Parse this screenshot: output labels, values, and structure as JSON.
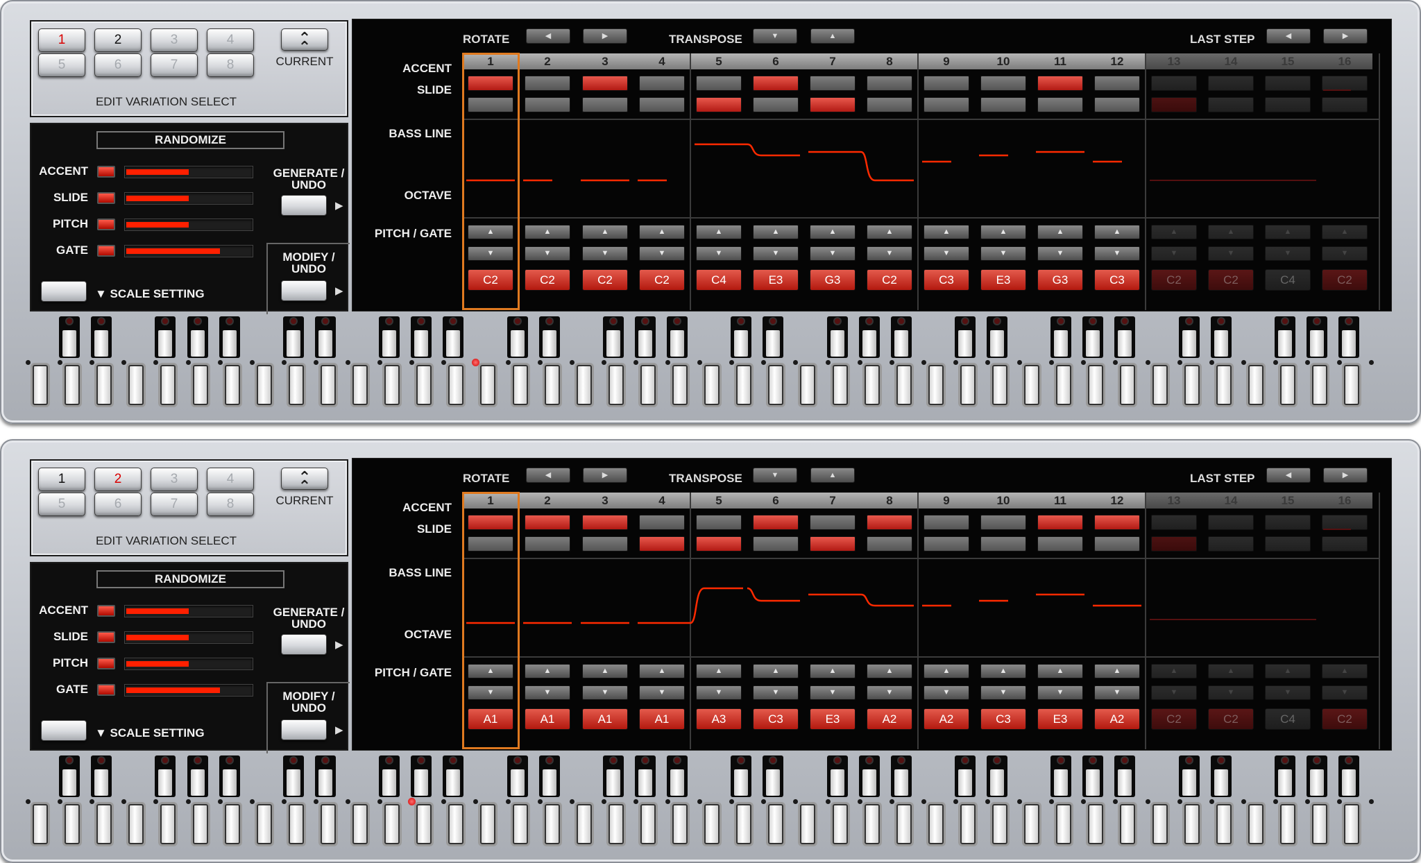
{
  "panels": [
    {
      "variation": {
        "buttons": [
          "1",
          "2",
          "3",
          "4",
          "5",
          "6",
          "7",
          "8"
        ],
        "selected": "2",
        "playing": "1",
        "current_label": "CURRENT",
        "current_icon": "double-chevron-up",
        "label": "EDIT VARIATION SELECT"
      },
      "randomize": {
        "title": "RANDOMIZE",
        "rows": [
          {
            "label": "ACCENT",
            "level": 0.5
          },
          {
            "label": "SLIDE",
            "level": 0.5
          },
          {
            "label": "PITCH",
            "level": 0.5
          },
          {
            "label": "GATE",
            "level": 0.75
          }
        ],
        "generate_label": "GENERATE / UNDO",
        "modify_label": "MODIFY / UNDO",
        "scale_label": "▼ SCALE SETTING"
      },
      "top": {
        "rotate_label": "ROTATE",
        "transpose_label": "TRANSPOSE",
        "last_step_label": "LAST STEP"
      },
      "rows": {
        "accent": "ACCENT",
        "slide": "SLIDE",
        "bass_line": "BASS LINE",
        "octave": "OCTAVE",
        "pitch_gate": "PITCH / GATE"
      },
      "steps": [
        "1",
        "2",
        "3",
        "4",
        "5",
        "6",
        "7",
        "8",
        "9",
        "10",
        "11",
        "12",
        "13",
        "14",
        "15",
        "16"
      ],
      "last_step": 12,
      "accent": [
        1,
        0,
        1,
        0,
        0,
        1,
        0,
        0,
        0,
        0,
        1,
        0,
        0,
        0,
        0,
        0
      ],
      "slide": [
        0,
        0,
        0,
        0,
        1,
        0,
        1,
        0,
        0,
        0,
        0,
        0,
        1,
        0,
        0,
        0
      ],
      "pitch": [
        "C2",
        "C2",
        "C2",
        "C2",
        "C4",
        "E3",
        "G3",
        "C2",
        "C3",
        "E3",
        "G3",
        "C3",
        "C2",
        "C2",
        "C4",
        "C2"
      ],
      "keyboard_lit_note": "C3"
    },
    {
      "variation": {
        "buttons": [
          "1",
          "2",
          "3",
          "4",
          "5",
          "6",
          "7",
          "8"
        ],
        "selected": "1",
        "playing": "2",
        "current_label": "CURRENT",
        "current_icon": "double-chevron-up",
        "label": "EDIT VARIATION SELECT"
      },
      "randomize": {
        "title": "RANDOMIZE",
        "rows": [
          {
            "label": "ACCENT",
            "level": 0.5
          },
          {
            "label": "SLIDE",
            "level": 0.5
          },
          {
            "label": "PITCH",
            "level": 0.5
          },
          {
            "label": "GATE",
            "level": 0.75
          }
        ],
        "generate_label": "GENERATE / UNDO",
        "modify_label": "MODIFY / UNDO",
        "scale_label": "▼ SCALE SETTING"
      },
      "top": {
        "rotate_label": "ROTATE",
        "transpose_label": "TRANSPOSE",
        "last_step_label": "LAST STEP"
      },
      "rows": {
        "accent": "ACCENT",
        "slide": "SLIDE",
        "bass_line": "BASS LINE",
        "octave": "OCTAVE",
        "pitch_gate": "PITCH / GATE"
      },
      "steps": [
        "1",
        "2",
        "3",
        "4",
        "5",
        "6",
        "7",
        "8",
        "9",
        "10",
        "11",
        "12",
        "13",
        "14",
        "15",
        "16"
      ],
      "last_step": 12,
      "accent": [
        1,
        1,
        1,
        0,
        0,
        1,
        0,
        1,
        0,
        0,
        1,
        1,
        0,
        0,
        0,
        0
      ],
      "slide": [
        0,
        0,
        0,
        1,
        1,
        0,
        1,
        0,
        0,
        0,
        0,
        0,
        1,
        0,
        0,
        0
      ],
      "pitch": [
        "A1",
        "A1",
        "A1",
        "A1",
        "A3",
        "C3",
        "E3",
        "A2",
        "A2",
        "C3",
        "E3",
        "A2",
        "C2",
        "C2",
        "C4",
        "C2"
      ],
      "keyboard_lit_note": "A2"
    }
  ],
  "colors": {
    "accent_on": "#d6322a",
    "playhead": "#e07a20",
    "bass_line": "#ff2a00"
  }
}
